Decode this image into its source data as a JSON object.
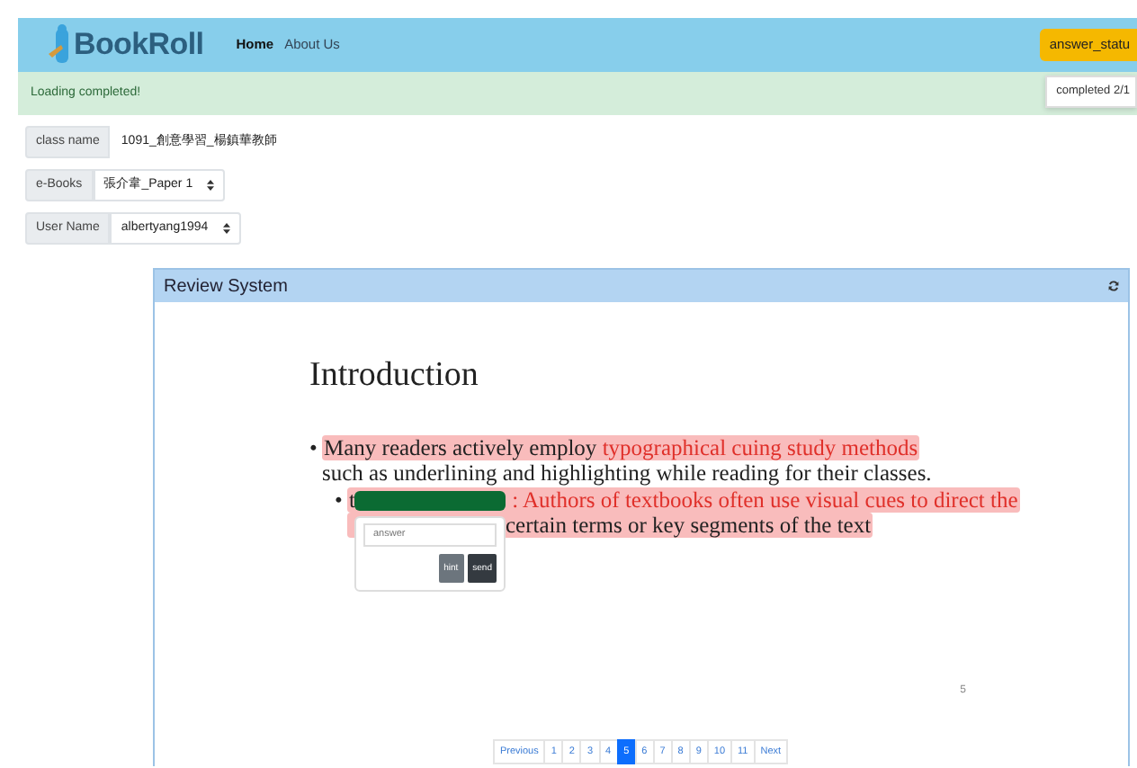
{
  "navbar": {
    "brand": "BookRoll",
    "links": [
      {
        "label": "Home",
        "selected": true
      },
      {
        "label": "About Us",
        "selected": false
      }
    ],
    "status_button": "answer_statu",
    "status_tooltip": "completed 2/1"
  },
  "alert": "Loading completed!",
  "fields": [
    {
      "kind": "text",
      "label": "class name",
      "value": "1091_創意學習_楊鎮華教師"
    },
    {
      "kind": "select",
      "label": "e-Books",
      "value": "張介韋_Paper 1"
    },
    {
      "kind": "select",
      "label": "User Name",
      "value": "albertyang1994"
    }
  ],
  "panel": {
    "title": "Review System",
    "slide": {
      "heading": "Introduction",
      "bullets": [
        {
          "marker": "•",
          "lines": [
            {
              "highlighted": true,
              "parts": [
                {
                  "kind": "plain",
                  "text": "Many readers actively employ "
                },
                {
                  "kind": "red",
                  "text": "typographical cuing study methods"
                }
              ]
            },
            {
              "highlighted": false,
              "parts": [
                {
                  "kind": "plain",
                  "text": "such as underlining and highlighting while reading for their classes."
                }
              ]
            }
          ],
          "children": [
            {
              "marker": "•",
              "lines": [
                {
                  "highlighted": true,
                  "parts": [
                    {
                      "kind": "plain",
                      "text": "t"
                    },
                    {
                      "kind": "blank"
                    },
                    {
                      "kind": "red",
                      "text": " : Authors of textbooks often use visual cues to direct the"
                    }
                  ]
                },
                {
                  "highlighted": true,
                  "parts": [
                    {
                      "kind": "plain",
                      "text": "certain terms or key segments of the text"
                    }
                  ]
                }
              ]
            }
          ]
        }
      ],
      "answer_popover": {
        "placeholder": "answer",
        "buttons": [
          {
            "kind": "secondary",
            "label": "hint"
          },
          {
            "kind": "dark",
            "label": "send"
          }
        ]
      },
      "page_number": "5"
    },
    "pagination": [
      {
        "label": "Previous",
        "selected": false
      },
      {
        "label": "1",
        "selected": false
      },
      {
        "label": "2",
        "selected": false
      },
      {
        "label": "3",
        "selected": false
      },
      {
        "label": "4",
        "selected": false
      },
      {
        "label": "5",
        "selected": true
      },
      {
        "label": "6",
        "selected": false
      },
      {
        "label": "7",
        "selected": false
      },
      {
        "label": "8",
        "selected": false
      },
      {
        "label": "9",
        "selected": false
      },
      {
        "label": "10",
        "selected": false
      },
      {
        "label": "11",
        "selected": false
      },
      {
        "label": "Next",
        "selected": false
      }
    ]
  }
}
